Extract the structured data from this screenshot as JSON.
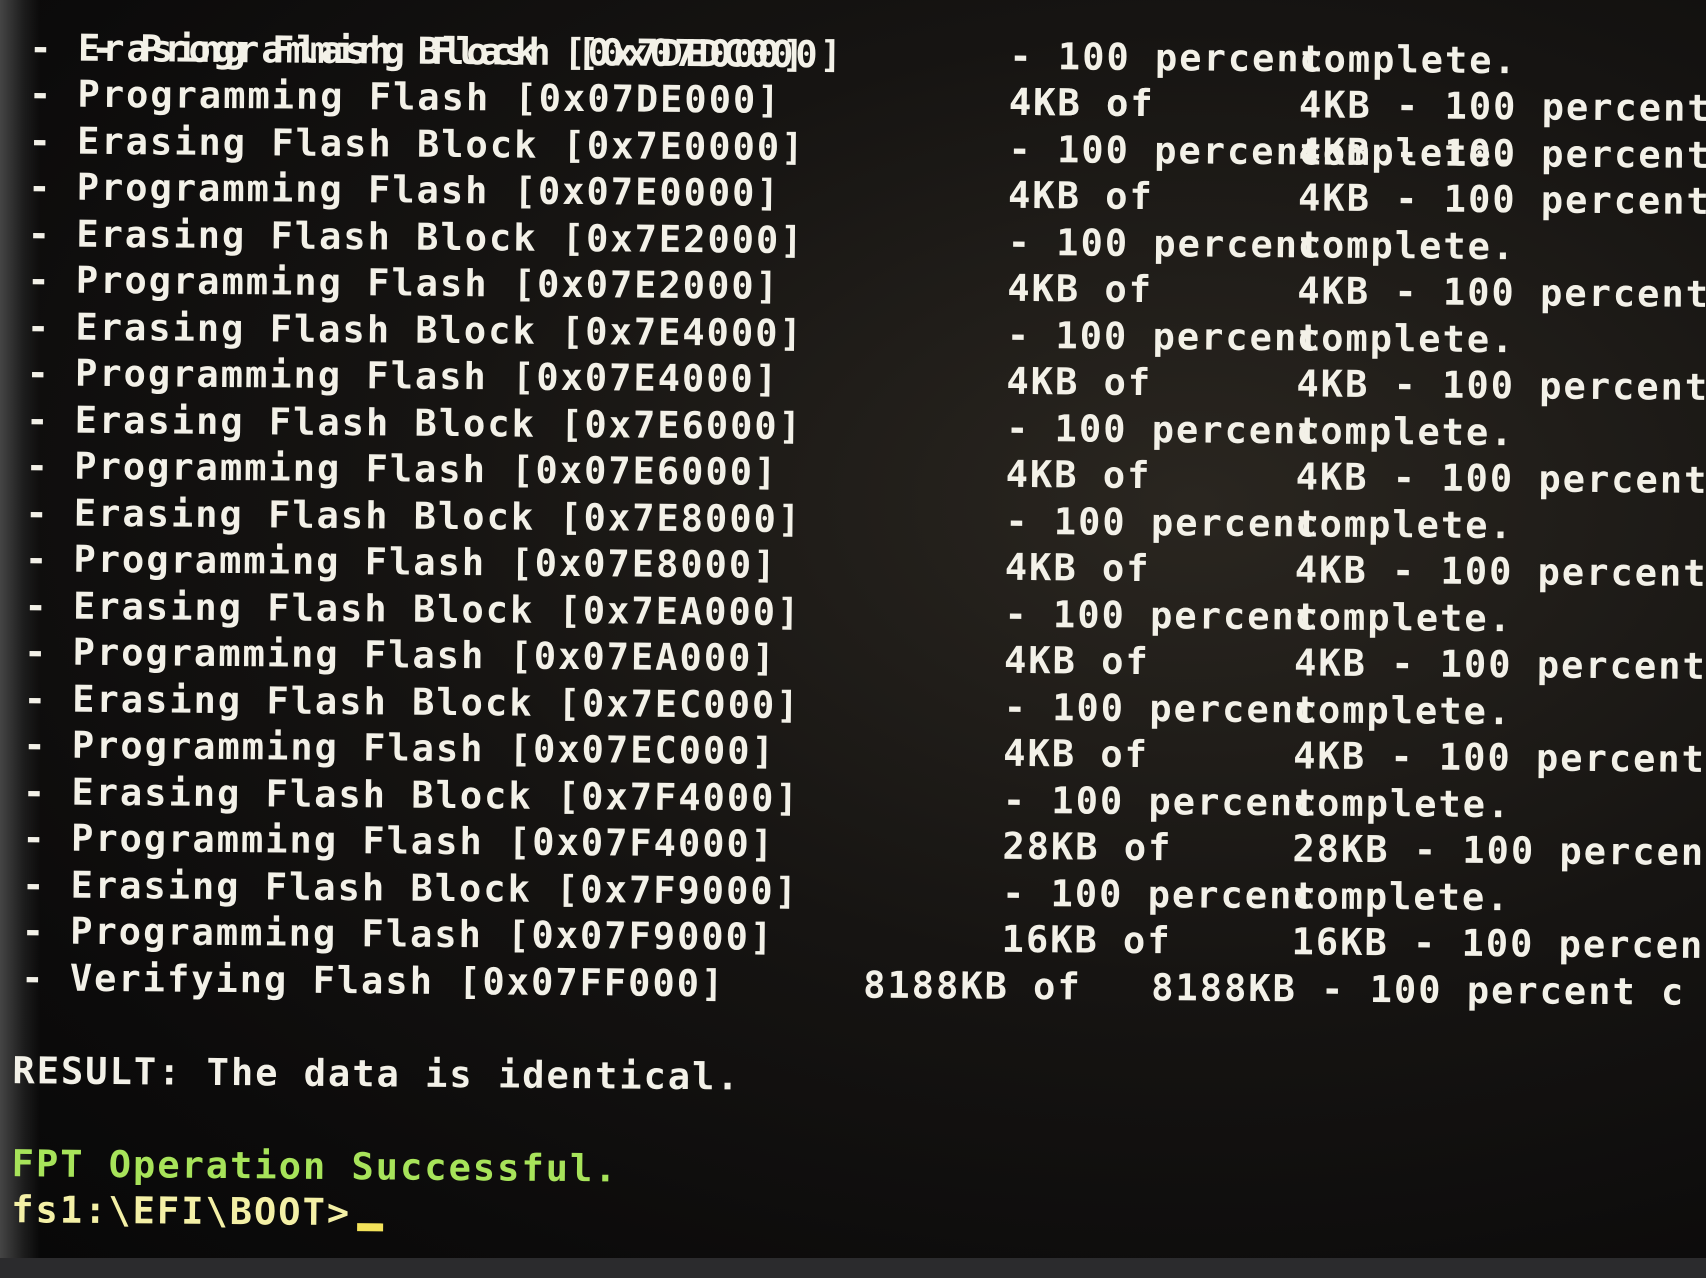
{
  "terminal": {
    "top_line": {
      "op": "- Programming Flash [0x07DC000]",
      "progress": "4KB of",
      "tail": "4KB - 100 percent"
    },
    "lines": [
      {
        "op": "- Erasing Flash Block [0x7DE000]",
        "progress": "- 100 percent",
        "tail": "complete."
      },
      {
        "op": "- Programming Flash [0x07DE000]",
        "progress": "4KB of",
        "tail": "4KB - 100 percent"
      },
      {
        "op": "- Erasing Flash Block [0x7E0000]",
        "progress": "- 100 percent",
        "tail": "complete."
      },
      {
        "op": "- Programming Flash [0x07E0000]",
        "progress": "4KB of",
        "tail": "4KB - 100 percent"
      },
      {
        "op": "- Erasing Flash Block [0x7E2000]",
        "progress": "- 100 percent",
        "tail": "complete."
      },
      {
        "op": "- Programming Flash [0x07E2000]",
        "progress": "4KB of",
        "tail": "4KB - 100 percent"
      },
      {
        "op": "- Erasing Flash Block [0x7E4000]",
        "progress": "- 100 percent",
        "tail": "complete."
      },
      {
        "op": "- Programming Flash [0x07E4000]",
        "progress": "4KB of",
        "tail": "4KB - 100 percent"
      },
      {
        "op": "- Erasing Flash Block [0x7E6000]",
        "progress": "- 100 percent",
        "tail": "complete."
      },
      {
        "op": "- Programming Flash [0x07E6000]",
        "progress": "4KB of",
        "tail": "4KB - 100 percent"
      },
      {
        "op": "- Erasing Flash Block [0x7E8000]",
        "progress": "- 100 percent",
        "tail": "complete."
      },
      {
        "op": "- Programming Flash [0x07E8000]",
        "progress": "4KB of",
        "tail": "4KB - 100 percent"
      },
      {
        "op": "- Erasing Flash Block [0x7EA000]",
        "progress": "- 100 percent",
        "tail": "complete."
      },
      {
        "op": "- Programming Flash [0x07EA000]",
        "progress": "4KB of",
        "tail": "4KB - 100 percent"
      },
      {
        "op": "- Erasing Flash Block [0x7EC000]",
        "progress": "- 100 percent",
        "tail": "complete."
      },
      {
        "op": "- Programming Flash [0x07EC000]",
        "progress": "4KB of",
        "tail": "4KB - 100 percent"
      },
      {
        "op": "- Erasing Flash Block [0x7F4000]",
        "progress": "- 100 percent",
        "tail": "complete."
      },
      {
        "op": "- Programming Flash [0x07F4000]",
        "progress": "28KB of",
        "tail": "28KB - 100 percent"
      },
      {
        "op": "- Erasing Flash Block [0x7F9000]",
        "progress": "- 100 percent",
        "tail": "complete."
      },
      {
        "op": "- Programming Flash [0x07F9000]",
        "progress": "16KB of",
        "tail": "16KB - 100 percent"
      },
      {
        "op": "- Verifying Flash [0x07FF000]",
        "progress": "8188KB of",
        "tail": "8188KB - 100 percent c"
      }
    ],
    "result": "RESULT: The data is identical.",
    "success": "FPT Operation Successful.",
    "prompt": "fs1:\\EFI\\BOOT>",
    "colors": {
      "text": "#f3f1e8",
      "success": "#a7e35a",
      "prompt": "#f4f0a6",
      "cursor": "#f3e25a"
    }
  }
}
